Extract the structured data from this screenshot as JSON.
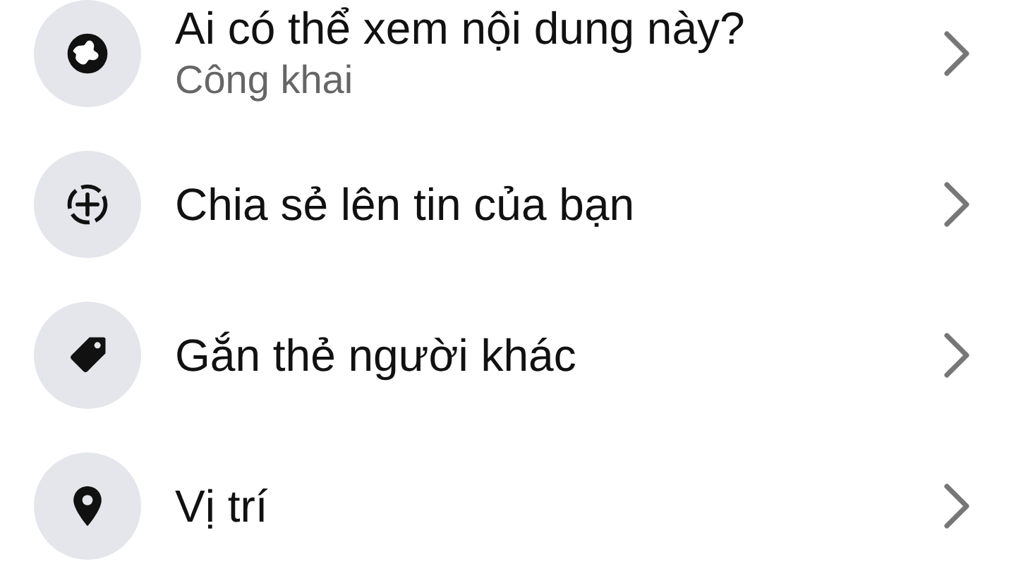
{
  "items": [
    {
      "kind": "globe",
      "title": "Ai có thể xem nội dung này?",
      "subtitle": "Công khai"
    },
    {
      "kind": "story",
      "title": "Chia sẻ lên tin của bạn"
    },
    {
      "kind": "tag",
      "title": "Gắn thẻ người khác"
    },
    {
      "kind": "pin",
      "title": "Vị trí"
    }
  ]
}
